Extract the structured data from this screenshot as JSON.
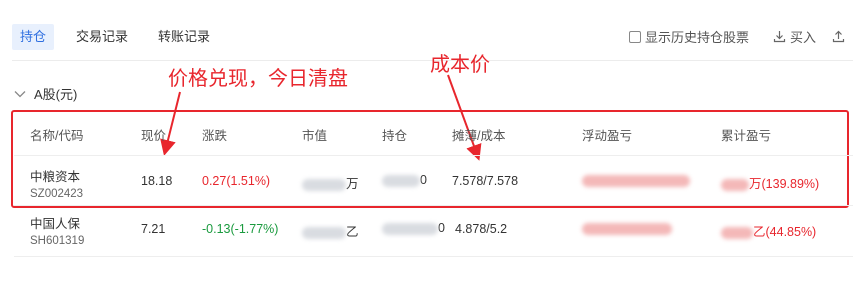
{
  "tabs": [
    {
      "label": "持仓"
    },
    {
      "label": "交易记录"
    },
    {
      "label": "转账记录"
    }
  ],
  "toolbar": {
    "show_history_label": "显示历史持仓股票",
    "buy_label": "买入"
  },
  "section": {
    "title": "A股(元)"
  },
  "annotations": {
    "price_note": "价格兑现，今日清盘",
    "cost_note": "成本价"
  },
  "table": {
    "headers": [
      "名称/代码",
      "现价",
      "涨跌",
      "市值",
      "持仓",
      "摊薄/成本",
      "浮动盈亏",
      "累计盈亏"
    ],
    "rows": [
      {
        "name": "中粮资本",
        "code": "SZ002423",
        "price": "18.18",
        "change": "0.27(1.51%)",
        "market_value_suffix": "万",
        "position_suffix": "0",
        "cost": "7.578/7.578",
        "cumulative_pl": "万(139.89%)"
      },
      {
        "name": "中国人保",
        "code": "SH601319",
        "price": "7.21",
        "change": "-0.13(-1.77%)",
        "market_value_suffix": "乙",
        "position_suffix": "0",
        "cost": "4.878/5.2",
        "cumulative_pl": "乙(44.85%)"
      }
    ]
  },
  "colors": {
    "accent": "#2f6fe0",
    "up": "#e8262d",
    "down": "#1a9a3e",
    "annotation": "#e8262d"
  }
}
